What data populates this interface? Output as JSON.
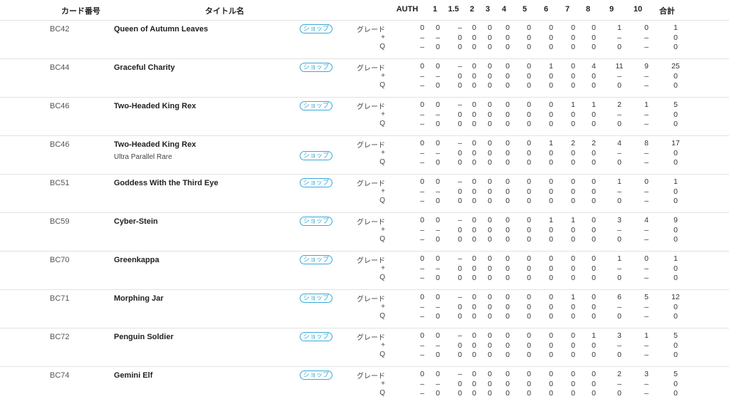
{
  "header": {
    "card_no": "カード番号",
    "title": "タイトル名",
    "grades": [
      "AUTH",
      "1",
      "1.5",
      "2",
      "3",
      "4",
      "5",
      "6",
      "7",
      "8",
      "9",
      "10",
      "合計"
    ]
  },
  "shop_label": "ショップ",
  "sub_labels": [
    "グレード",
    "+",
    "Q"
  ],
  "cards": [
    {
      "code": "BC42",
      "title": "Queen of Autumn Leaves",
      "subtitle": "",
      "grade": [
        "0",
        "0",
        "–",
        "0",
        "0",
        "0",
        "0",
        "0",
        "0",
        "0",
        "1",
        "0",
        "1"
      ],
      "plus": [
        "–",
        "–",
        "0",
        "0",
        "0",
        "0",
        "0",
        "0",
        "0",
        "0",
        "–",
        "–",
        "0"
      ],
      "q": [
        "–",
        "0",
        "0",
        "0",
        "0",
        "0",
        "0",
        "0",
        "0",
        "0",
        "0",
        "–",
        "0"
      ]
    },
    {
      "code": "BC44",
      "title": "Graceful Charity",
      "subtitle": "",
      "grade": [
        "0",
        "0",
        "–",
        "0",
        "0",
        "0",
        "0",
        "1",
        "0",
        "4",
        "11",
        "9",
        "25"
      ],
      "plus": [
        "–",
        "–",
        "0",
        "0",
        "0",
        "0",
        "0",
        "0",
        "0",
        "0",
        "–",
        "–",
        "0"
      ],
      "q": [
        "–",
        "0",
        "0",
        "0",
        "0",
        "0",
        "0",
        "0",
        "0",
        "0",
        "0",
        "–",
        "0"
      ]
    },
    {
      "code": "BC46",
      "title": "Two-Headed King Rex",
      "subtitle": "",
      "grade": [
        "0",
        "0",
        "–",
        "0",
        "0",
        "0",
        "0",
        "0",
        "1",
        "1",
        "2",
        "1",
        "5"
      ],
      "plus": [
        "–",
        "–",
        "0",
        "0",
        "0",
        "0",
        "0",
        "0",
        "0",
        "0",
        "–",
        "–",
        "0"
      ],
      "q": [
        "–",
        "0",
        "0",
        "0",
        "0",
        "0",
        "0",
        "0",
        "0",
        "0",
        "0",
        "–",
        "0"
      ]
    },
    {
      "code": "BC46",
      "title": "Two-Headed King Rex",
      "subtitle": "Ultra Parallel Rare",
      "grade": [
        "0",
        "0",
        "–",
        "0",
        "0",
        "0",
        "0",
        "1",
        "2",
        "2",
        "4",
        "8",
        "17"
      ],
      "plus": [
        "–",
        "–",
        "0",
        "0",
        "0",
        "0",
        "0",
        "0",
        "0",
        "0",
        "–",
        "–",
        "0"
      ],
      "q": [
        "–",
        "0",
        "0",
        "0",
        "0",
        "0",
        "0",
        "0",
        "0",
        "0",
        "0",
        "–",
        "0"
      ]
    },
    {
      "code": "BC51",
      "title": "Goddess With the Third Eye",
      "subtitle": "",
      "grade": [
        "0",
        "0",
        "–",
        "0",
        "0",
        "0",
        "0",
        "0",
        "0",
        "0",
        "1",
        "0",
        "1"
      ],
      "plus": [
        "–",
        "–",
        "0",
        "0",
        "0",
        "0",
        "0",
        "0",
        "0",
        "0",
        "–",
        "–",
        "0"
      ],
      "q": [
        "–",
        "0",
        "0",
        "0",
        "0",
        "0",
        "0",
        "0",
        "0",
        "0",
        "0",
        "–",
        "0"
      ]
    },
    {
      "code": "BC59",
      "title": "Cyber-Stein",
      "subtitle": "",
      "grade": [
        "0",
        "0",
        "–",
        "0",
        "0",
        "0",
        "0",
        "1",
        "1",
        "0",
        "3",
        "4",
        "9"
      ],
      "plus": [
        "–",
        "–",
        "0",
        "0",
        "0",
        "0",
        "0",
        "0",
        "0",
        "0",
        "–",
        "–",
        "0"
      ],
      "q": [
        "–",
        "0",
        "0",
        "0",
        "0",
        "0",
        "0",
        "0",
        "0",
        "0",
        "0",
        "–",
        "0"
      ]
    },
    {
      "code": "BC70",
      "title": "Greenkappa",
      "subtitle": "",
      "grade": [
        "0",
        "0",
        "–",
        "0",
        "0",
        "0",
        "0",
        "0",
        "0",
        "0",
        "1",
        "0",
        "1"
      ],
      "plus": [
        "–",
        "–",
        "0",
        "0",
        "0",
        "0",
        "0",
        "0",
        "0",
        "0",
        "–",
        "–",
        "0"
      ],
      "q": [
        "–",
        "0",
        "0",
        "0",
        "0",
        "0",
        "0",
        "0",
        "0",
        "0",
        "0",
        "–",
        "0"
      ]
    },
    {
      "code": "BC71",
      "title": "Morphing Jar",
      "subtitle": "",
      "grade": [
        "0",
        "0",
        "–",
        "0",
        "0",
        "0",
        "0",
        "0",
        "1",
        "0",
        "6",
        "5",
        "12"
      ],
      "plus": [
        "–",
        "–",
        "0",
        "0",
        "0",
        "0",
        "0",
        "0",
        "0",
        "0",
        "–",
        "–",
        "0"
      ],
      "q": [
        "–",
        "0",
        "0",
        "0",
        "0",
        "0",
        "0",
        "0",
        "0",
        "0",
        "0",
        "–",
        "0"
      ]
    },
    {
      "code": "BC72",
      "title": "Penguin Soldier",
      "subtitle": "",
      "grade": [
        "0",
        "0",
        "–",
        "0",
        "0",
        "0",
        "0",
        "0",
        "0",
        "1",
        "3",
        "1",
        "5"
      ],
      "plus": [
        "–",
        "–",
        "0",
        "0",
        "0",
        "0",
        "0",
        "0",
        "0",
        "0",
        "–",
        "–",
        "0"
      ],
      "q": [
        "–",
        "0",
        "0",
        "0",
        "0",
        "0",
        "0",
        "0",
        "0",
        "0",
        "0",
        "–",
        "0"
      ]
    },
    {
      "code": "BC74",
      "title": "Gemini Elf",
      "subtitle": "",
      "grade": [
        "0",
        "0",
        "–",
        "0",
        "0",
        "0",
        "0",
        "0",
        "0",
        "0",
        "2",
        "3",
        "5"
      ],
      "plus": [
        "–",
        "–",
        "0",
        "0",
        "0",
        "0",
        "0",
        "0",
        "0",
        "0",
        "–",
        "–",
        "0"
      ],
      "q": [
        "–",
        "0",
        "0",
        "0",
        "0",
        "0",
        "0",
        "0",
        "0",
        "0",
        "0",
        "–",
        "0"
      ]
    }
  ]
}
